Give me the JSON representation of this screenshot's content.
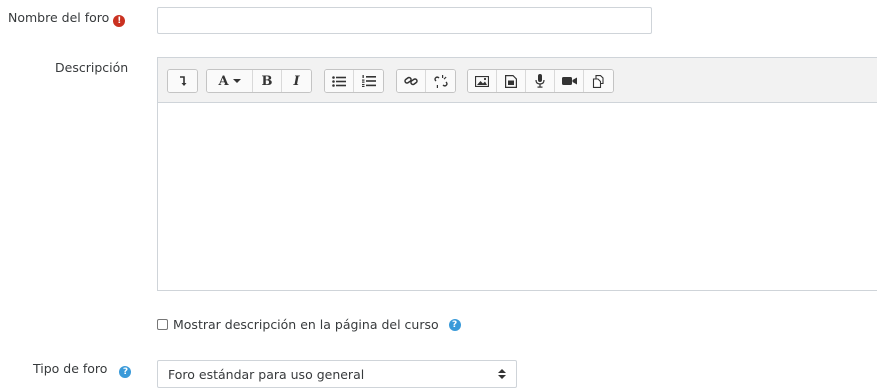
{
  "form": {
    "forum_name_label": "Nombre del foro",
    "required_glyph": "!",
    "forum_name_value": "",
    "description_label": "Descripción",
    "show_description_label": "Mostrar descripción en la página del curso",
    "help_glyph": "?",
    "forum_type_label": "Tipo de foro",
    "forum_type_selected": "Foro estándar para uso general"
  },
  "editor": {
    "font_button_label": "A",
    "bold_label": "B",
    "italic_label": "I",
    "toolbar_icons": [
      "collapse-icon",
      "font-style-icon",
      "bold-icon",
      "italic-icon",
      "unordered-list-icon",
      "ordered-list-icon",
      "link-icon",
      "unlink-icon",
      "image-icon",
      "media-icon",
      "microphone-icon",
      "video-icon",
      "manage-files-icon"
    ]
  },
  "colors": {
    "required": "#ca3120",
    "help": "#3a9ad9",
    "border": "#cfd4d9",
    "toolbar_bg": "#f2f2f2"
  }
}
